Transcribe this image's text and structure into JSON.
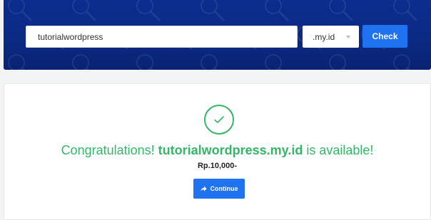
{
  "search": {
    "domain_value": "tutorialwordpress",
    "tld_selected": ".my.id",
    "check_label": "Check"
  },
  "result": {
    "prefix": "Congratulations! ",
    "domain": "tutorialwordpress.my.id",
    "suffix": " is available!",
    "price": "Rp.10,000-",
    "continue_label": "Continue"
  },
  "icons": {
    "search_pattern": "magnifier-icon",
    "success": "checkmark-icon",
    "continue": "arrow-right-icon",
    "select_caret": "chevron-down-icon"
  },
  "colors": {
    "banner": "#0b2a84",
    "button": "#1f73f0",
    "success": "#35b567"
  }
}
